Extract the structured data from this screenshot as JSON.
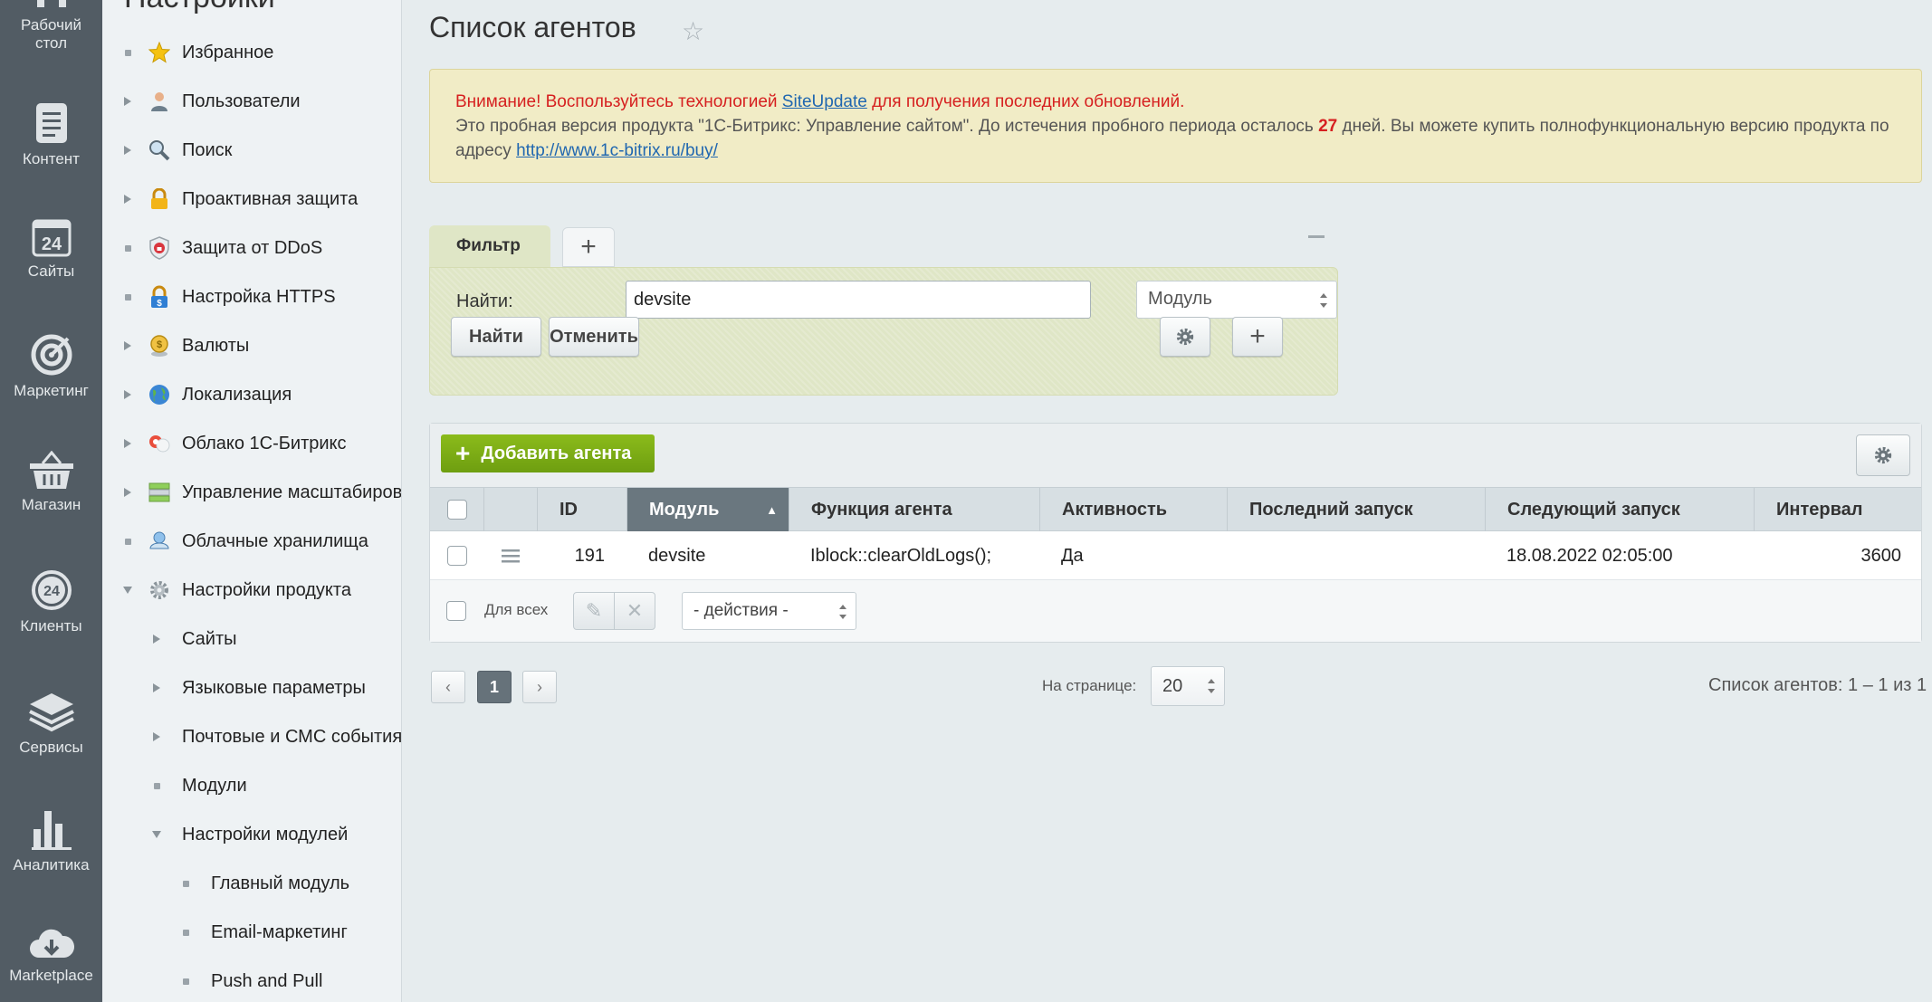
{
  "iconbar": {
    "items": [
      {
        "label": "Рабочий\nстол",
        "icon": "desktop-icon"
      },
      {
        "label": "Контент",
        "icon": "content-icon"
      },
      {
        "label": "Сайты",
        "icon": "sites-icon"
      },
      {
        "label": "Маркетинг",
        "icon": "marketing-icon"
      },
      {
        "label": "Магазин",
        "icon": "shop-icon"
      },
      {
        "label": "Клиенты",
        "icon": "clients-icon"
      },
      {
        "label": "Сервисы",
        "icon": "services-icon"
      },
      {
        "label": "Аналитика",
        "icon": "analytics-icon"
      },
      {
        "label": "Marketplace",
        "icon": "marketplace-icon"
      }
    ]
  },
  "menu": {
    "title": "Настройки",
    "items": [
      {
        "label": "Избранное"
      },
      {
        "label": "Пользователи"
      },
      {
        "label": "Поиск"
      },
      {
        "label": "Проактивная защита"
      },
      {
        "label": "Защита от DDoS"
      },
      {
        "label": "Настройка HTTPS"
      },
      {
        "label": "Валюты"
      },
      {
        "label": "Локализация"
      },
      {
        "label": "Облако 1С-Битрикс"
      },
      {
        "label": "Управление масштабирова"
      },
      {
        "label": "Облачные хранилища"
      },
      {
        "label": "Настройки продукта"
      },
      {
        "label": "Сайты"
      },
      {
        "label": "Языковые параметры"
      },
      {
        "label": "Почтовые и СМС события"
      },
      {
        "label": "Модули"
      },
      {
        "label": "Настройки модулей"
      },
      {
        "label": "Главный модуль"
      },
      {
        "label": "Email-маркетинг"
      },
      {
        "label": "Push and Pull"
      }
    ]
  },
  "page": {
    "title": "Список агентов"
  },
  "notice": {
    "warning_prefix": "Внимание! Воспользуйтесь технологией ",
    "siteupdate_link": "SiteUpdate",
    "warning_suffix": " для получения последних обновлений.",
    "trial_text": "Это пробная версия продукта \"1С-Битрикс: Управление сайтом\". До истечения пробного периода осталось ",
    "days": "27",
    "trial_text_2": " дней. Вы можете купить полнофункциональную версию продукта по адресу ",
    "buy_link": "http://www.1c-bitrix.ru/buy/"
  },
  "filter": {
    "tab_label": "Фильтр",
    "find_label": "Найти:",
    "find_value": "devsite",
    "field_select": "Модуль",
    "find_button": "Найти",
    "cancel_button": "Отменить"
  },
  "grid": {
    "add_button": "Добавить агента",
    "columns": [
      "ID",
      "Модуль",
      "Функция агента",
      "Активность",
      "Последний запуск",
      "Следующий запуск",
      "Интервал"
    ],
    "rows": [
      {
        "id": "191",
        "module": "devsite",
        "function": "Iblock::clearOldLogs();",
        "active": "Да",
        "last_run": "",
        "next_run": "18.08.2022 02:05:00",
        "interval": "3600"
      }
    ],
    "for_all_label": "Для всех",
    "actions_select": "- действия -"
  },
  "pagination": {
    "current_page": "1",
    "per_page_label": "На странице:",
    "per_page_value": "20",
    "count_text": "Список агентов: 1 – 1 из 1"
  },
  "colors": {
    "iconbar_bg": "#525c64",
    "add_button": "#7cad14",
    "warning_red": "#d62020",
    "link_blue": "#2067b0"
  }
}
